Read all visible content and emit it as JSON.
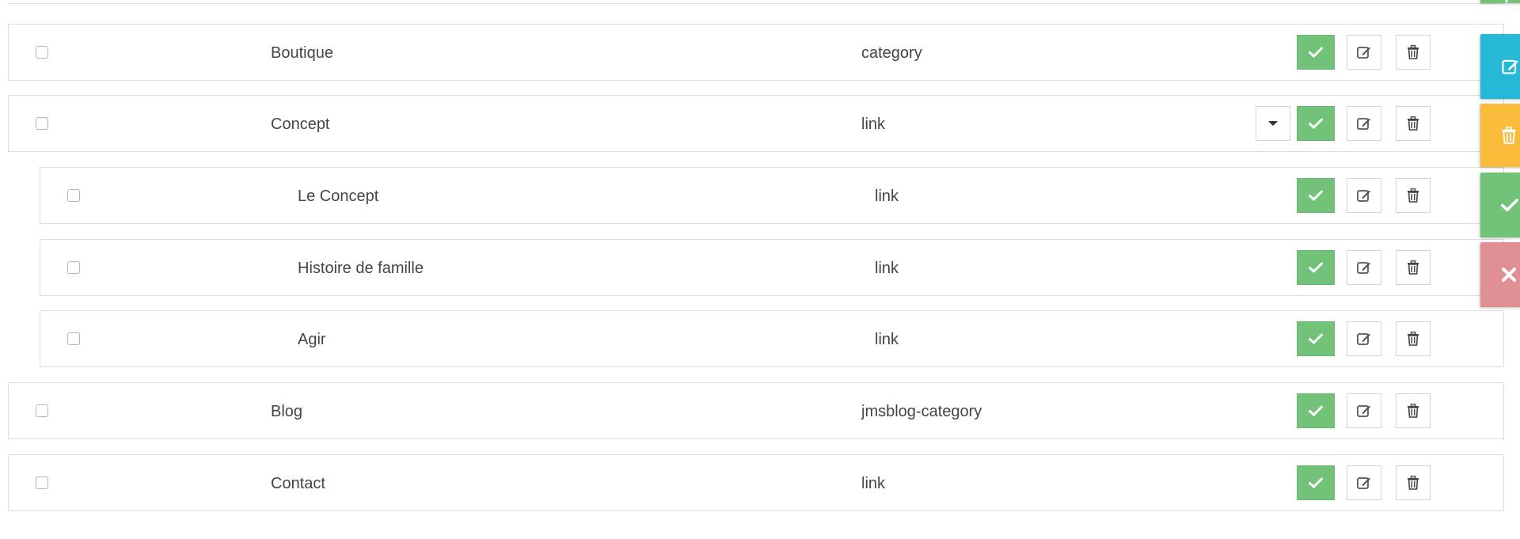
{
  "rows": [
    {
      "title": "Boutique",
      "type": "category",
      "level": 0,
      "has_children": false
    },
    {
      "title": "Concept",
      "type": "link",
      "level": 0,
      "has_children": true
    },
    {
      "title": "Le Concept",
      "type": "link",
      "level": 1,
      "has_children": false
    },
    {
      "title": "Histoire de famille",
      "type": "link",
      "level": 1,
      "has_children": false
    },
    {
      "title": "Agir",
      "type": "link",
      "level": 1,
      "has_children": false
    },
    {
      "title": "Blog",
      "type": "jmsblog-category",
      "level": 0,
      "has_children": false
    },
    {
      "title": "Contact",
      "type": "link",
      "level": 0,
      "has_children": false
    }
  ],
  "icons": {
    "status": "check-icon",
    "edit": "pencil-square-icon",
    "delete": "trash-icon",
    "toggle": "caret-down-icon"
  },
  "side_toolbar": [
    {
      "name": "add",
      "icon": "plus-icon",
      "color": "#72c279"
    },
    {
      "name": "edit",
      "icon": "pencil-square-icon",
      "color": "#25b9d7"
    },
    {
      "name": "delete",
      "icon": "trash-icon",
      "color": "#fbbb3b"
    },
    {
      "name": "enable",
      "icon": "check-icon",
      "color": "#72c279"
    },
    {
      "name": "disable",
      "icon": "x-icon",
      "color": "#e08f95"
    }
  ],
  "colors": {
    "status_enabled": "#72c279",
    "row_border": "#dddddd",
    "text": "#444444"
  }
}
